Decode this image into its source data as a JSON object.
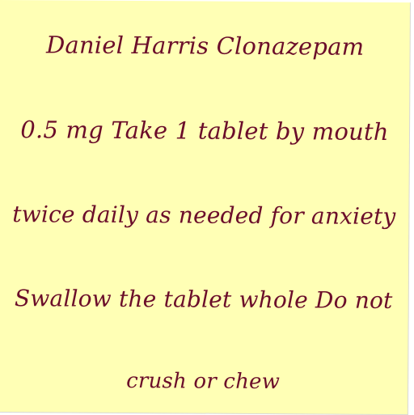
{
  "note": {
    "lines": [
      "Daniel Harris Clonazepam",
      "0.5 mg Take 1 tablet by mouth",
      "twice daily as needed for anxiety",
      "Swallow the tablet whole Do not",
      "crush or chew"
    ],
    "background_color": "#ffffb5",
    "text_color": "#6b0d2a"
  }
}
